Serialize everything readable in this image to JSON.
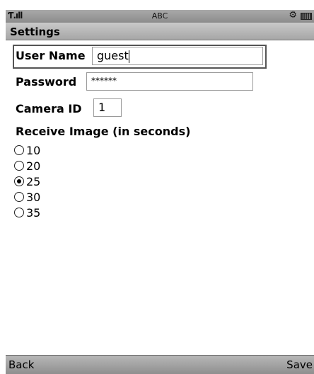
{
  "status_bar": {
    "mode": "ABC"
  },
  "header": {
    "title": "Settings"
  },
  "form": {
    "user_name": {
      "label": "User Name",
      "value": "guest"
    },
    "password": {
      "label": "Password",
      "value": "******"
    },
    "camera_id": {
      "label": "Camera ID",
      "value": "1"
    },
    "receive_image": {
      "label": "Receive Image (in seconds)",
      "options": [
        "10",
        "20",
        "25",
        "30",
        "35"
      ],
      "selected": "25"
    }
  },
  "softkeys": {
    "left": "Back",
    "right": "Save"
  }
}
